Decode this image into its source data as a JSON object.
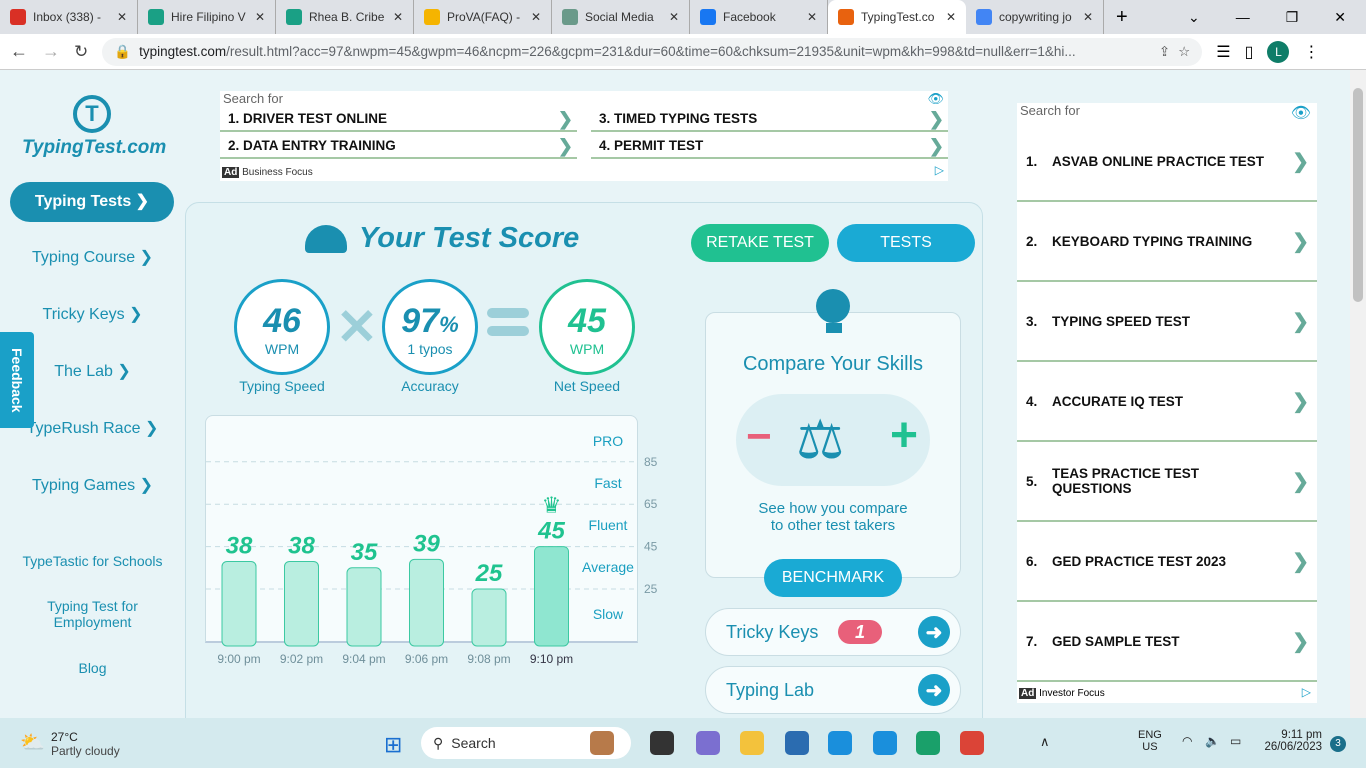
{
  "browser": {
    "tabs": [
      {
        "label": "Inbox (338) -",
        "color": "#d93025"
      },
      {
        "label": "Hire Filipino V",
        "color": "#1aa085"
      },
      {
        "label": "Rhea B. Cribe",
        "color": "#1aa085"
      },
      {
        "label": "ProVA(FAQ) -",
        "color": "#f5b400"
      },
      {
        "label": "Social Media",
        "color": "#6a9a8a"
      },
      {
        "label": "Facebook",
        "color": "#1877f2"
      },
      {
        "label": "TypingTest.co",
        "color": "#e8620f"
      },
      {
        "label": "copywriting jo",
        "color": "#4285f4"
      }
    ],
    "active_tab": 6,
    "url_domain": "typingtest.com",
    "url_rest": "/result.html?acc=97&nwpm=45&gwpm=46&ncpm=226&gcpm=231&dur=60&time=60&chksum=21935&unit=wpm&kh=998&td=null&err=1&hi...",
    "profile_initial": "L"
  },
  "sidebar": {
    "logo": "TypingTest.com",
    "items": [
      "Typing Tests",
      "Typing Course",
      "Tricky Keys",
      "The Lab",
      "TypeRush Race",
      "Typing Games"
    ],
    "links": [
      "TypeTastic for Schools",
      "Typing Test for Employment",
      "Blog"
    ],
    "feedback": "Feedback"
  },
  "top_ad": {
    "search_for": "Search for",
    "items": [
      "1. DRIVER TEST ONLINE",
      "3. TIMED TYPING TESTS",
      "2. DATA ENTRY TRAINING",
      "4. PERMIT TEST"
    ],
    "byline": "Business Focus",
    "ad_label": "Ad"
  },
  "score": {
    "title": "Your Test Score",
    "retake": "RETAKE TEST",
    "tests": "TESTS",
    "speed": {
      "value": "46",
      "unit": "WPM",
      "label": "Typing Speed"
    },
    "accuracy": {
      "value": "97",
      "pct": "%",
      "sub": "1  typos",
      "label": "Accuracy"
    },
    "net": {
      "value": "45",
      "unit": "WPM",
      "label": "Net Speed"
    }
  },
  "chart_data": {
    "type": "bar",
    "categories": [
      "9:00 pm",
      "9:02 pm",
      "9:04 pm",
      "9:06 pm",
      "9:08 pm",
      "9:10 pm"
    ],
    "values": [
      38,
      38,
      35,
      39,
      25,
      45
    ],
    "highlight": 5,
    "yticks": [
      25,
      45,
      65,
      85
    ],
    "ylim": [
      0,
      103
    ],
    "levels": [
      "PRO",
      "Fast",
      "Fluent",
      "Average",
      "Slow"
    ]
  },
  "compare": {
    "title": "Compare Your Skills",
    "text1": "See how you compare",
    "text2": "to other test takers",
    "button": "BENCHMARK"
  },
  "links": {
    "tricky": "Tricky Keys",
    "tricky_count": "1",
    "lab": "Typing Lab"
  },
  "side_ad": {
    "search_for": "Search for",
    "items": [
      {
        "n": "1.",
        "t": "ASVAB ONLINE PRACTICE TEST"
      },
      {
        "n": "2.",
        "t": "KEYBOARD TYPING TRAINING"
      },
      {
        "n": "3.",
        "t": "TYPING SPEED TEST"
      },
      {
        "n": "4.",
        "t": "ACCURATE IQ TEST"
      },
      {
        "n": "5.",
        "t": "TEAS PRACTICE TEST QUESTIONS"
      },
      {
        "n": "6.",
        "t": "GED PRACTICE TEST 2023"
      },
      {
        "n": "7.",
        "t": "GED SAMPLE TEST"
      }
    ],
    "byline": "Investor Focus",
    "ad_label": "Ad"
  },
  "taskbar": {
    "temp": "27°C",
    "weather": "Partly cloudy",
    "search": "Search",
    "lang1": "ENG",
    "lang2": "US",
    "time": "9:11 pm",
    "date": "26/06/2023",
    "notif": "3"
  }
}
